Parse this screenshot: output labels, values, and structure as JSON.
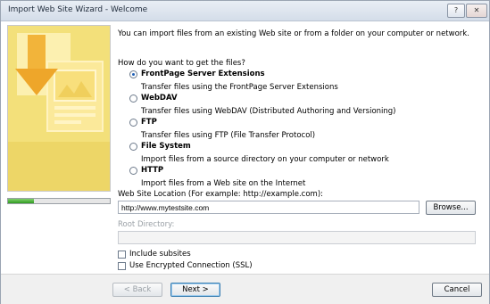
{
  "window": {
    "title": "Import Web Site Wizard - Welcome",
    "help_glyph": "?",
    "close_glyph": "✕"
  },
  "wizard": {
    "progress_fraction": 0.25
  },
  "intro": "You can import files from an existing Web site or from a folder on your computer or network.",
  "question": "How do you want to get the files?",
  "options": [
    {
      "label": "FrontPage Server Extensions",
      "description": "Transfer files using the FrontPage Server Extensions",
      "selected": true
    },
    {
      "label": "WebDAV",
      "description": "Transfer files using WebDAV (Distributed Authoring and Versioning)",
      "selected": false
    },
    {
      "label": "FTP",
      "description": "Transfer files using FTP (File Transfer Protocol)",
      "selected": false
    },
    {
      "label": "File System",
      "description": "Import files from a source directory on your computer or network",
      "selected": false
    },
    {
      "label": "HTTP",
      "description": "Import files from a Web site on the Internet",
      "selected": false
    }
  ],
  "location": {
    "label": "Web Site Location (For example: http://example.com):",
    "value": "http://www.mytestsite.com",
    "browse_label": "Browse..."
  },
  "root": {
    "label": "Root Directory:",
    "value": ""
  },
  "checkboxes": {
    "subsites": "Include subsites",
    "ssl": "Use Encrypted Connection (SSL)"
  },
  "buttons": {
    "back": "< Back",
    "next": "Next >",
    "cancel": "Cancel"
  },
  "colors": {
    "banner": "#f3e07a",
    "progress": "#2f9a20",
    "accent": "#1f5fb5"
  }
}
